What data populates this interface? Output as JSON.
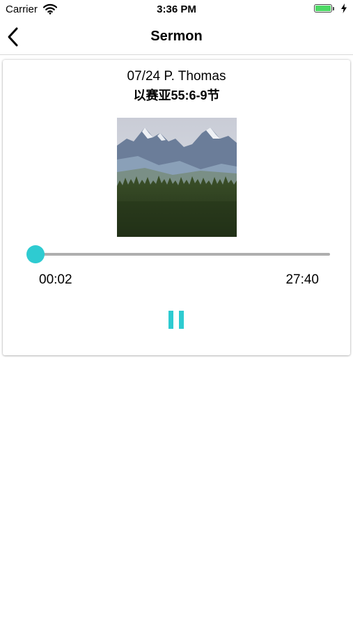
{
  "status_bar": {
    "carrier": "Carrier",
    "time": "3:36 PM",
    "wifi_icon": "wifi-icon",
    "battery_icon": "battery-full-icon",
    "charging_icon": "charging-bolt-icon"
  },
  "nav": {
    "title": "Sermon",
    "back_icon": "chevron-left-icon"
  },
  "sermon": {
    "date_speaker": "07/24 P. Thomas",
    "scripture": "以赛亚55:6-9节",
    "artwork": "mountain-forest-landscape"
  },
  "player": {
    "elapsed": "00:02",
    "duration": "27:40",
    "progress_fraction": 0.0012,
    "control_icon": "pause-icon"
  },
  "colors": {
    "accent": "#2ecbd1",
    "track": "#aeaeae",
    "battery": "#4cd964"
  }
}
